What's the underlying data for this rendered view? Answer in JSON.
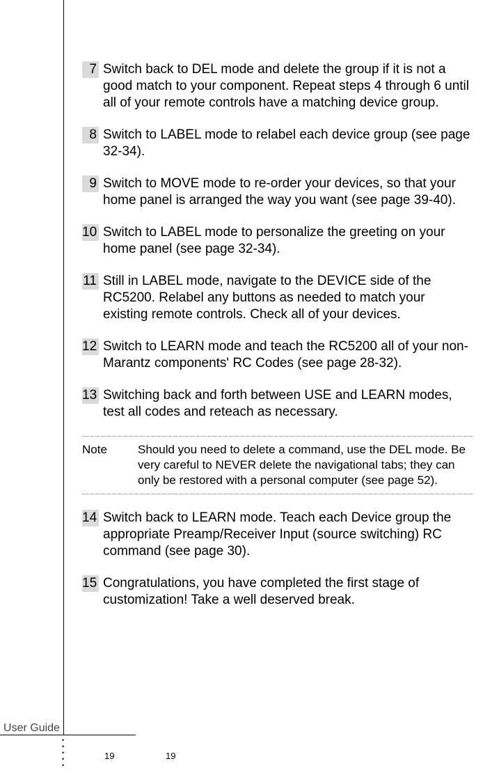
{
  "steps": [
    {
      "n": "7",
      "t": "Switch back to DEL mode and delete the group if it is not a good match to your component. Repeat steps 4 through 6 until all of your remote controls have a matching device group."
    },
    {
      "n": "8",
      "t": "Switch to LABEL mode to relabel each device group (see page 32-34)."
    },
    {
      "n": "9",
      "t": "Switch to MOVE mode to re-order your devices, so that your home panel is arranged the way you want (see page 39-40)."
    },
    {
      "n": "10",
      "t": "Switch to LABEL mode to personalize the greeting on your home panel (see page 32-34)."
    },
    {
      "n": "11",
      "t": "Still in LABEL mode, navigate to the DEVICE side of the RC5200. Relabel any buttons as needed to match your existing remote controls. Check all of your devices."
    },
    {
      "n": "12",
      "t": "Switch to LEARN mode and teach the RC5200 all of your non-Marantz components' RC Codes (see page 28-32)."
    },
    {
      "n": "13",
      "t": "Switching back and forth between USE and LEARN modes, test all codes and reteach as necessary."
    }
  ],
  "note": {
    "label": "Note",
    "text": "Should you need to delete a command, use the DEL mode. Be very careful to NEVER delete the navigational tabs; they can only be restored with a personal computer (see page 52)."
  },
  "steps2": [
    {
      "n": "14",
      "t": "Switch back to LEARN mode. Teach each Device group the appropriate Preamp/Receiver Input (source switching) RC command (see page 30)."
    },
    {
      "n": "15",
      "t": "Congratulations, you have completed the first stage of customization! Take a well deserved break."
    }
  ],
  "footer": "User Guide",
  "page": "19"
}
